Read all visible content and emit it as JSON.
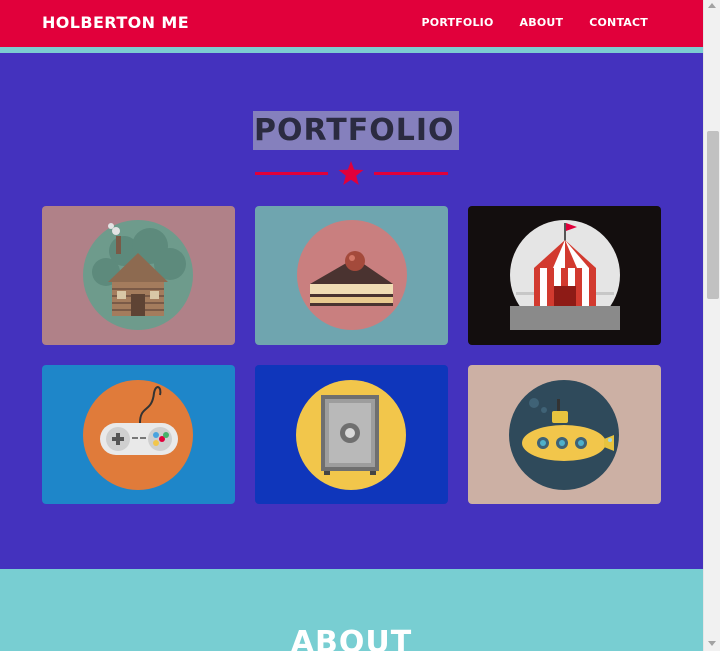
{
  "navbar": {
    "brand": "HOLBERTON ME",
    "links": [
      {
        "label": "PORTFOLIO"
      },
      {
        "label": "ABOUT"
      },
      {
        "label": "CONTACT"
      }
    ]
  },
  "portfolio": {
    "title": "PORTFOLIO",
    "tiles": [
      {
        "icon": "log-cabin-icon",
        "bg": "#b08188"
      },
      {
        "icon": "cake-slice-icon",
        "bg": "#6fa5af"
      },
      {
        "icon": "circus-tent-icon",
        "bg": "#130e0e"
      },
      {
        "icon": "game-controller-icon",
        "bg": "#1e86c9"
      },
      {
        "icon": "safe-icon",
        "bg": "#0f36bb"
      },
      {
        "icon": "submarine-icon",
        "bg": "#ccb0a4"
      }
    ]
  },
  "about": {
    "title": "ABOUT"
  },
  "colors": {
    "accent": "#e1003b",
    "portfolio_bg": "#4432be",
    "about_bg": "#78ced2",
    "nav_stripe": "#7ccdd1"
  }
}
